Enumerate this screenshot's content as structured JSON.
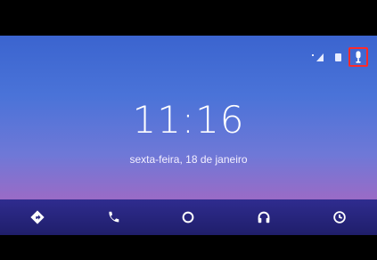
{
  "clock": {
    "time": "11:16",
    "date": "sexta-feira, 18 de janeiro"
  },
  "status": {
    "icons": [
      "signal-icon",
      "battery-icon",
      "microphone-icon"
    ],
    "highlight_color": "#ff2a2a"
  },
  "navbar": {
    "items": [
      {
        "icon": "navigation-icon"
      },
      {
        "icon": "phone-icon"
      },
      {
        "icon": "home-icon"
      },
      {
        "icon": "headphones-icon"
      },
      {
        "icon": "recents-icon"
      }
    ]
  }
}
